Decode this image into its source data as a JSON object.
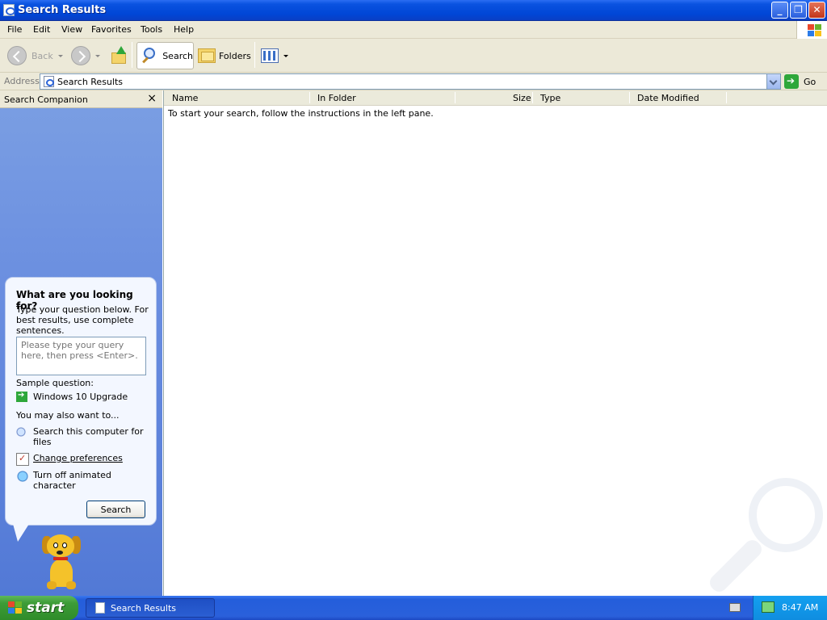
{
  "window": {
    "title": "Search Results"
  },
  "menu": [
    "File",
    "Edit",
    "View",
    "Favorites",
    "Tools",
    "Help"
  ],
  "toolbar": {
    "back": "Back",
    "search": "Search",
    "folders": "Folders"
  },
  "address": {
    "label": "Address",
    "value": "Search Results",
    "go": "Go"
  },
  "companion": {
    "title": "Search Companion",
    "close": "×",
    "heading": "What are you looking for?",
    "instructions": "Type your question below. For best results, use complete sentences.",
    "query_placeholder": "Please type your query here, then press <Enter>.",
    "sample_label": "Sample question:",
    "sample": "Windows 10 Upgrade",
    "also_label": "You may also want to...",
    "options": [
      "Search this computer for files",
      "Change preferences",
      "Turn off animated character"
    ],
    "search_button": "Search"
  },
  "results": {
    "columns": [
      "Name",
      "In Folder",
      "Size",
      "Type",
      "Date Modified"
    ],
    "message": "To start your search, follow the instructions in the left pane."
  },
  "taskbar": {
    "start": "start",
    "task": "Search Results",
    "clock": "8:47 AM"
  }
}
